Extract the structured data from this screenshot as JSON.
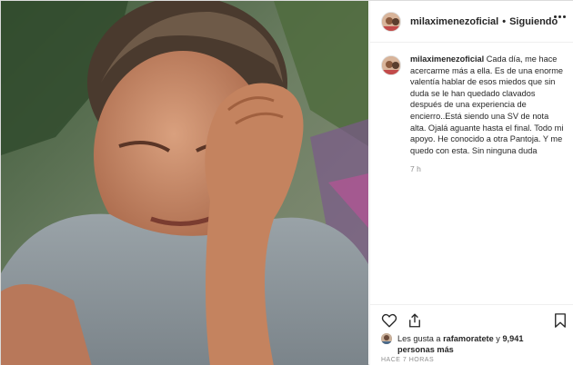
{
  "post": {
    "username": "milaximenezoficial",
    "separator": "•",
    "follow_status": "Siguiendo",
    "caption": "Cada día, me hace acercarme más a ella. Es de una enorme valentía hablar de esos miedos que sin duda se le han quedado clavados después de una experiencia de encierro..Está siendo una SV de nota alta. Ojalá aguante hasta el final. Todo mi apoyo. He conocido a otra Pantoja. Y me quedo con esta. Sin ninguna duda",
    "caption_age": "7 h",
    "likes_prefix": "Les gusta a ",
    "likes_user": "rafamoratete",
    "likes_joiner": " y ",
    "likes_count": "9,941 personas más",
    "posted_time": "HACE 7 HORAS"
  },
  "icons": {
    "more": "ellipsis-icon",
    "like": "heart-icon",
    "share": "share-icon",
    "save": "bookmark-icon"
  },
  "colors": {
    "text": "#262626",
    "secondary": "#8e8e8e",
    "border": "#dbdbdb"
  }
}
